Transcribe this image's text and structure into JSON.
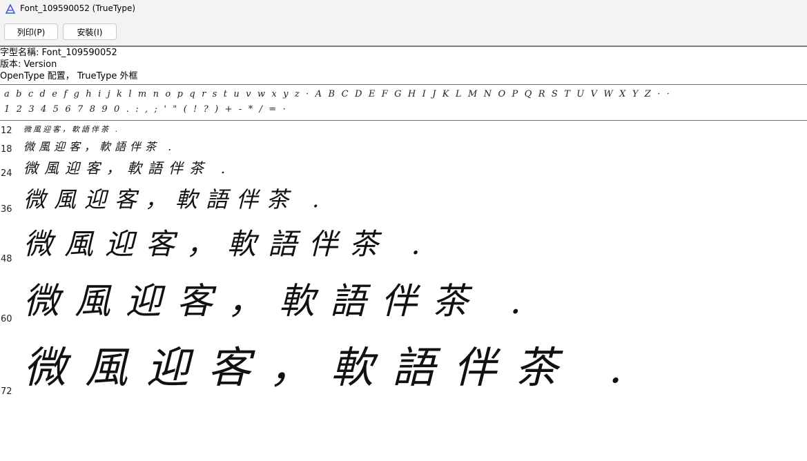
{
  "window": {
    "title": "Font_109590052 (TrueType)"
  },
  "toolbar": {
    "print_label": "列印(P)",
    "install_label": "安裝(I)"
  },
  "info": {
    "font_name_line": "字型名稱: Font_109590052",
    "version_line": "版本: Version",
    "type_line": "OpenType 配置， TrueType 外框"
  },
  "charset": {
    "line1": "abcdefghijklmnopqrstuvwxyz·ABCDEFGHIJKLMNOPQRSTUVWXYZ··",
    "line2": "1234567890.:,;'\"(!?)+-*/=·"
  },
  "samples": {
    "text": "微風迎客，軟語伴茶 .",
    "rows": [
      {
        "size": "12"
      },
      {
        "size": "18"
      },
      {
        "size": "24"
      },
      {
        "size": "36"
      },
      {
        "size": "48"
      },
      {
        "size": "60"
      },
      {
        "size": "72"
      }
    ]
  }
}
